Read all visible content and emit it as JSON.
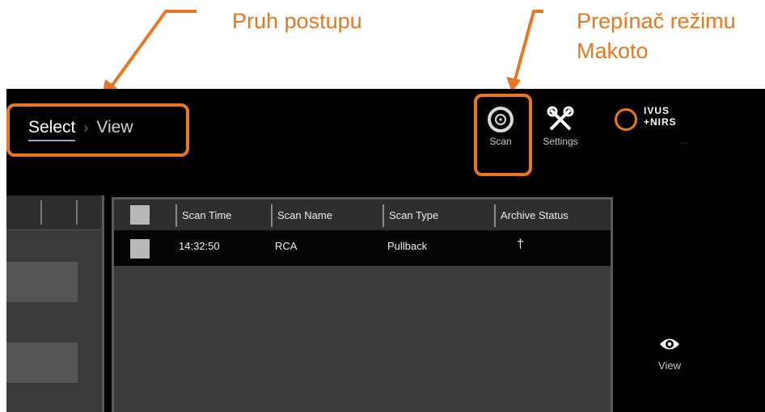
{
  "callouts": {
    "progress_bar": "Pruh postupu",
    "mode_toggle_line1": "Prepínač režimu",
    "mode_toggle_line2": "Makoto"
  },
  "breadcrumb": {
    "step1": "Select",
    "separator": "›",
    "step2": "View"
  },
  "toolbar": {
    "scan_label": "Scan",
    "settings_label": "Settings"
  },
  "logo": {
    "line1": "IVUS",
    "line2": "+NIRS"
  },
  "table": {
    "columns": [
      "Scan Time",
      "Scan Name",
      "Scan Type",
      "Archive Status"
    ],
    "rows": [
      {
        "scan_time": "14:32:50",
        "scan_name": "RCA",
        "scan_type": "Pullback",
        "archive_status": "†"
      }
    ]
  },
  "side_panel": {
    "view_label": "View"
  },
  "colors": {
    "accent": "#e87722",
    "background": "#000000",
    "panel": "#3c3c3c"
  },
  "icons": [
    "scan-icon",
    "settings-icon",
    "eye-icon",
    "archive-status-icon"
  ]
}
